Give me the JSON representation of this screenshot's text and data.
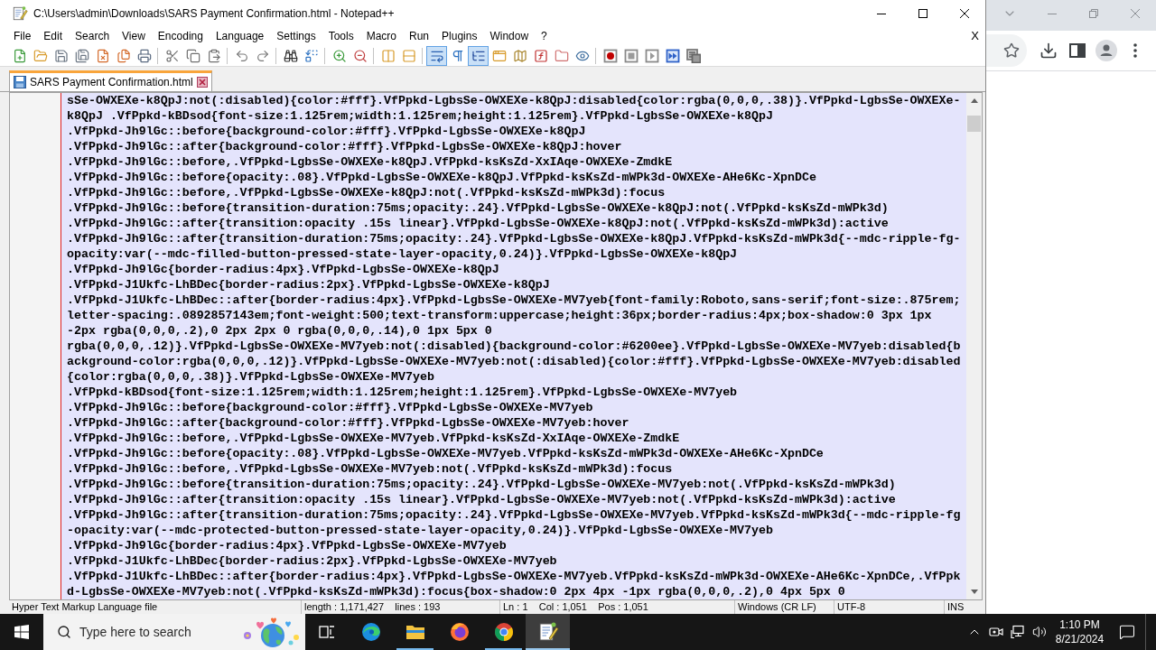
{
  "window": {
    "title": "C:\\Users\\admin\\Downloads\\SARS Payment Confirmation.html - Notepad++"
  },
  "menu": [
    "File",
    "Edit",
    "Search",
    "View",
    "Encoding",
    "Language",
    "Settings",
    "Tools",
    "Macro",
    "Run",
    "Plugins",
    "Window",
    "?"
  ],
  "close_document_button": "X",
  "toolbar": [
    [
      {
        "pressed": false
      },
      {
        "pressed": false
      },
      {
        "pressed": false
      },
      {
        "pressed": false
      },
      {
        "pressed": false
      },
      {
        "pressed": false
      },
      {
        "pressed": false
      }
    ],
    [
      {
        "pressed": false
      },
      {
        "pressed": false
      },
      {
        "pressed": false
      }
    ],
    [
      {
        "pressed": false
      },
      {
        "pressed": false
      }
    ],
    [
      {
        "pressed": false
      },
      {
        "pressed": false
      }
    ],
    [
      {
        "pressed": false
      },
      {
        "pressed": false
      }
    ],
    [
      {
        "pressed": false
      },
      {
        "pressed": false
      }
    ],
    [
      {
        "pressed": true
      },
      {
        "pressed": false
      },
      {
        "pressed": true
      },
      {
        "pressed": false
      },
      {
        "pressed": false
      },
      {
        "pressed": false
      },
      {
        "pressed": false
      },
      {
        "pressed": false
      }
    ],
    [
      {
        "pressed": false
      },
      {
        "pressed": false
      },
      {
        "pressed": false
      },
      {
        "pressed": false
      },
      {
        "pressed": false
      }
    ]
  ],
  "tabs": [
    {
      "label": "SARS Payment Confirmation.html",
      "selected": true
    }
  ],
  "editor": {
    "selected": true,
    "lines": [
      "sSe-OWXEXe-k8QpJ:not(:disabled){color:#fff}.VfPpkd-LgbsSe-OWXEXe-k8QpJ:disabled{color:rgba(0,0,0,.38)}.VfPpkd-LgbsSe-OWXEXe-",
      "k8QpJ .VfPpkd-kBDsod{font-size:1.125rem;width:1.125rem;height:1.125rem}.VfPpkd-LgbsSe-OWXEXe-k8QpJ",
      ".VfPpkd-Jh9lGc::before{background-color:#fff}.VfPpkd-LgbsSe-OWXEXe-k8QpJ",
      ".VfPpkd-Jh9lGc::after{background-color:#fff}.VfPpkd-LgbsSe-OWXEXe-k8QpJ:hover",
      ".VfPpkd-Jh9lGc::before,.VfPpkd-LgbsSe-OWXEXe-k8QpJ.VfPpkd-ksKsZd-XxIAqe-OWXEXe-ZmdkE",
      ".VfPpkd-Jh9lGc::before{opacity:.08}.VfPpkd-LgbsSe-OWXEXe-k8QpJ.VfPpkd-ksKsZd-mWPk3d-OWXEXe-AHe6Kc-XpnDCe",
      ".VfPpkd-Jh9lGc::before,.VfPpkd-LgbsSe-OWXEXe-k8QpJ:not(.VfPpkd-ksKsZd-mWPk3d):focus",
      ".VfPpkd-Jh9lGc::before{transition-duration:75ms;opacity:.24}.VfPpkd-LgbsSe-OWXEXe-k8QpJ:not(.VfPpkd-ksKsZd-mWPk3d)",
      ".VfPpkd-Jh9lGc::after{transition:opacity .15s linear}.VfPpkd-LgbsSe-OWXEXe-k8QpJ:not(.VfPpkd-ksKsZd-mWPk3d):active",
      ".VfPpkd-Jh9lGc::after{transition-duration:75ms;opacity:.24}.VfPpkd-LgbsSe-OWXEXe-k8QpJ.VfPpkd-ksKsZd-mWPk3d{--mdc-ripple-fg-",
      "opacity:var(--mdc-filled-button-pressed-state-layer-opacity,0.24)}.VfPpkd-LgbsSe-OWXEXe-k8QpJ",
      ".VfPpkd-Jh9lGc{border-radius:4px}.VfPpkd-LgbsSe-OWXEXe-k8QpJ",
      ".VfPpkd-J1Ukfc-LhBDec{border-radius:2px}.VfPpkd-LgbsSe-OWXEXe-k8QpJ",
      ".VfPpkd-J1Ukfc-LhBDec::after{border-radius:4px}.VfPpkd-LgbsSe-OWXEXe-MV7yeb{font-family:Roboto,sans-serif;font-size:.875rem;",
      "letter-spacing:.0892857143em;font-weight:500;text-transform:uppercase;height:36px;border-radius:4px;box-shadow:0 3px 1px",
      "-2px rgba(0,0,0,.2),0 2px 2px 0 rgba(0,0,0,.14),0 1px 5px 0",
      "rgba(0,0,0,.12)}.VfPpkd-LgbsSe-OWXEXe-MV7yeb:not(:disabled){background-color:#6200ee}.VfPpkd-LgbsSe-OWXEXe-MV7yeb:disabled{b",
      "ackground-color:rgba(0,0,0,.12)}.VfPpkd-LgbsSe-OWXEXe-MV7yeb:not(:disabled){color:#fff}.VfPpkd-LgbsSe-OWXEXe-MV7yeb:disabled",
      "{color:rgba(0,0,0,.38)}.VfPpkd-LgbsSe-OWXEXe-MV7yeb",
      ".VfPpkd-kBDsod{font-size:1.125rem;width:1.125rem;height:1.125rem}.VfPpkd-LgbsSe-OWXEXe-MV7yeb",
      ".VfPpkd-Jh9lGc::before{background-color:#fff}.VfPpkd-LgbsSe-OWXEXe-MV7yeb",
      ".VfPpkd-Jh9lGc::after{background-color:#fff}.VfPpkd-LgbsSe-OWXEXe-MV7yeb:hover",
      ".VfPpkd-Jh9lGc::before,.VfPpkd-LgbsSe-OWXEXe-MV7yeb.VfPpkd-ksKsZd-XxIAqe-OWXEXe-ZmdkE",
      ".VfPpkd-Jh9lGc::before{opacity:.08}.VfPpkd-LgbsSe-OWXEXe-MV7yeb.VfPpkd-ksKsZd-mWPk3d-OWXEXe-AHe6Kc-XpnDCe",
      ".VfPpkd-Jh9lGc::before,.VfPpkd-LgbsSe-OWXEXe-MV7yeb:not(.VfPpkd-ksKsZd-mWPk3d):focus",
      ".VfPpkd-Jh9lGc::before{transition-duration:75ms;opacity:.24}.VfPpkd-LgbsSe-OWXEXe-MV7yeb:not(.VfPpkd-ksKsZd-mWPk3d)",
      ".VfPpkd-Jh9lGc::after{transition:opacity .15s linear}.VfPpkd-LgbsSe-OWXEXe-MV7yeb:not(.VfPpkd-ksKsZd-mWPk3d):active",
      ".VfPpkd-Jh9lGc::after{transition-duration:75ms;opacity:.24}.VfPpkd-LgbsSe-OWXEXe-MV7yeb.VfPpkd-ksKsZd-mWPk3d{--mdc-ripple-fg",
      "-opacity:var(--mdc-protected-button-pressed-state-layer-opacity,0.24)}.VfPpkd-LgbsSe-OWXEXe-MV7yeb",
      ".VfPpkd-Jh9lGc{border-radius:4px}.VfPpkd-LgbsSe-OWXEXe-MV7yeb",
      ".VfPpkd-J1Ukfc-LhBDec{border-radius:2px}.VfPpkd-LgbsSe-OWXEXe-MV7yeb",
      ".VfPpkd-J1Ukfc-LhBDec::after{border-radius:4px}.VfPpkd-LgbsSe-OWXEXe-MV7yeb.VfPpkd-ksKsZd-mWPk3d-OWXEXe-AHe6Kc-XpnDCe,.VfPpk",
      "d-LgbsSe-OWXEXe-MV7yeb:not(.VfPpkd-ksKsZd-mWPk3d):focus{box-shadow:0 2px 4px -1px rgba(0,0,0,.2),0 4px 5px 0"
    ]
  },
  "status_bar": [
    "Hyper Text Markup Language file",
    "length : 1,171,427    lines : 193",
    "Ln : 1    Col : 1,051    Pos : 1,051",
    "Windows (CR LF)",
    "UTF-8",
    "INS"
  ],
  "taskbar": {
    "search_placeholder": "Type here to search",
    "apps": [
      {
        "running": false,
        "selected": false
      },
      {
        "running": true,
        "selected": false
      },
      {
        "running": false,
        "selected": false
      },
      {
        "running": true,
        "selected": false
      },
      {
        "running": true,
        "selected": true
      }
    ],
    "clock": {
      "time": "1:10 PM",
      "date": "8/21/2024"
    }
  }
}
